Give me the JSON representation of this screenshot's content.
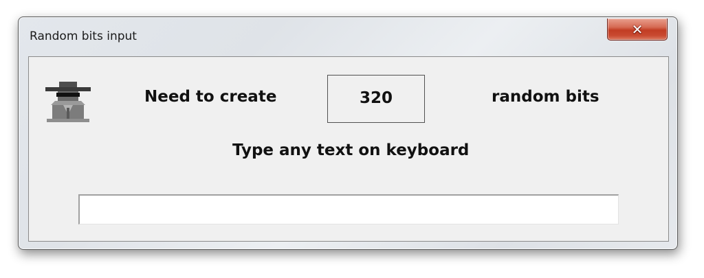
{
  "window": {
    "title": "Random bits input",
    "close_icon": "close-x-icon"
  },
  "dialog": {
    "icon": "spy-icon",
    "need_text": "Need to create",
    "bits_count": "320",
    "random_bits_text": "random bits",
    "instruction": "Type any text on keyboard",
    "input_value": "",
    "input_placeholder": ""
  },
  "colors": {
    "close_button": "#c94a31",
    "client_bg": "#f0f0f0"
  }
}
